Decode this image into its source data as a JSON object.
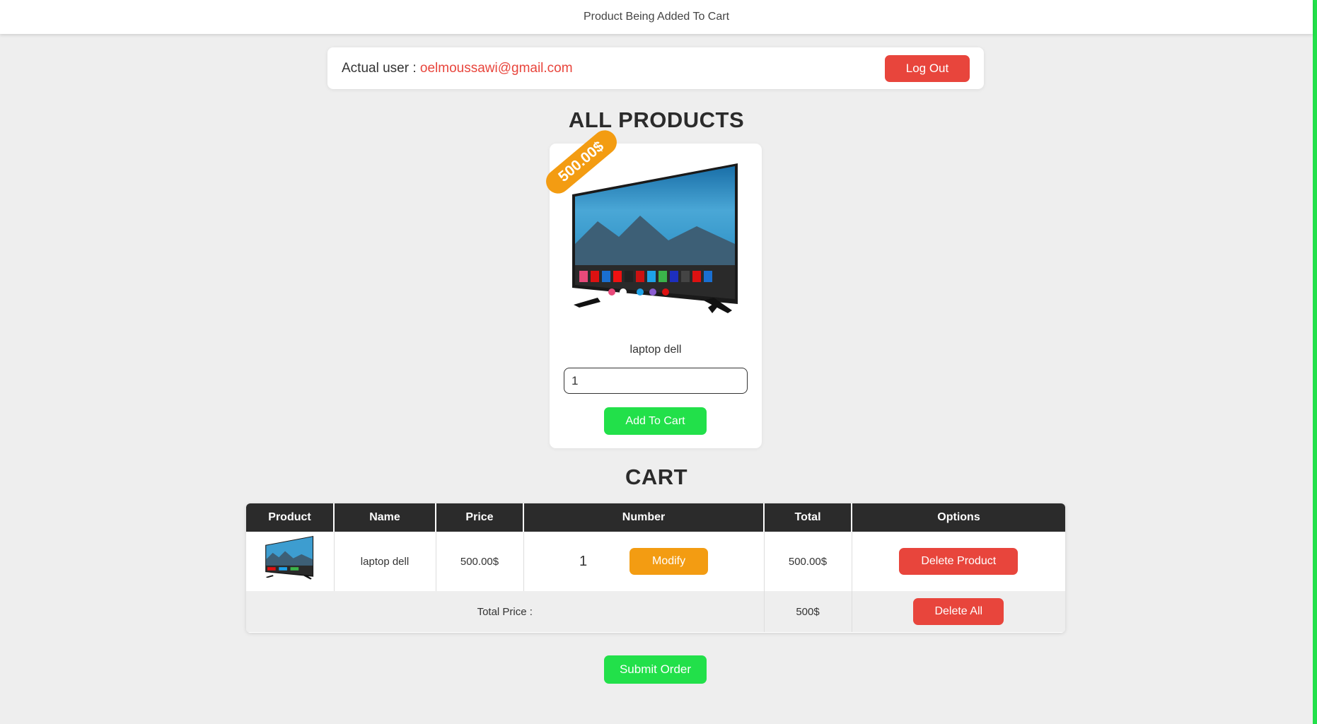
{
  "topbar": {
    "title": "Product Being Added To Cart"
  },
  "user": {
    "label": "Actual user : ",
    "email": "oelmoussawi@gmail.com",
    "logout_label": "Log Out"
  },
  "products": {
    "title": "ALL PRODUCTS",
    "items": [
      {
        "price_tag": "500.00$",
        "name": "laptop dell",
        "quantity": "1",
        "add_label": "Add To Cart",
        "image_icon": "tv-image"
      }
    ]
  },
  "cart": {
    "title": "CART",
    "columns": [
      "Product",
      "Name",
      "Price",
      "Number",
      "Total",
      "Options"
    ],
    "rows": [
      {
        "name": "laptop dell",
        "price": "500.00$",
        "number": "1",
        "modify_label": "Modify",
        "total": "500.00$",
        "delete_label": "Delete Product"
      }
    ],
    "total_label": "Total Price :",
    "total_value": "500$",
    "delete_all_label": "Delete All"
  },
  "submit_label": "Submit Order",
  "colors": {
    "accent_red": "#e8453c",
    "accent_green": "#22e04a",
    "accent_orange": "#f39c12",
    "header_dark": "#2b2b2b"
  }
}
